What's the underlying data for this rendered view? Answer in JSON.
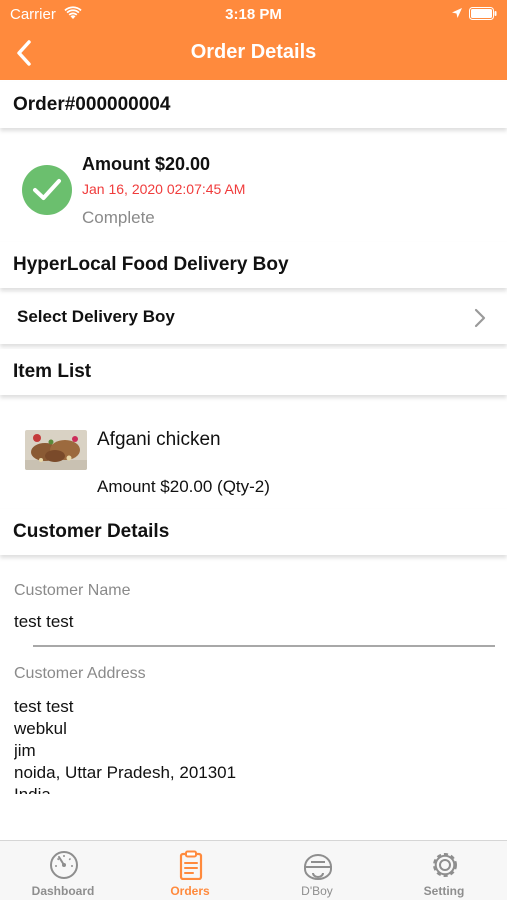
{
  "status_bar": {
    "carrier": "Carrier",
    "time": "3:18 PM"
  },
  "nav": {
    "title": "Order Details"
  },
  "order": {
    "number": "Order#000000004",
    "amount": "Amount $20.00",
    "date": "Jan 16, 2020 02:07:45 AM",
    "status": "Complete"
  },
  "delivery": {
    "header": "HyperLocal Food Delivery Boy",
    "select_label": "Select Delivery Boy"
  },
  "items": {
    "header": "Item List",
    "list": [
      {
        "name": "Afgani chicken",
        "amount": "Amount $20.00 (Qty-2)"
      }
    ]
  },
  "customer": {
    "header": "Customer Details",
    "name_label": "Customer Name",
    "name_value": "test test",
    "address_label": "Customer Address",
    "address_lines": [
      "test test",
      "webkul",
      "jim",
      "noida, Uttar Pradesh, 201301",
      "India"
    ]
  },
  "tabs": [
    {
      "label": "Dashboard",
      "icon": "dashboard-gauge-icon"
    },
    {
      "label": "Orders",
      "icon": "clipboard-icon"
    },
    {
      "label": "D'Boy",
      "icon": "delivery-helmet-icon"
    },
    {
      "label": "Setting",
      "icon": "gear-icon"
    }
  ],
  "colors": {
    "accent": "#FF8A3D",
    "success": "#6BBF6E",
    "date_red": "#F03C3C",
    "muted": "#8a8a8a"
  }
}
